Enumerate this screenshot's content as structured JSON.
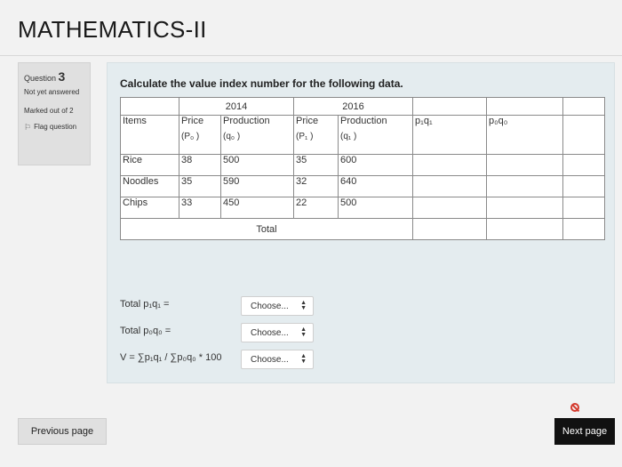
{
  "page": {
    "title": "MATHEMATICS-II"
  },
  "question_info": {
    "question_label": "Question",
    "question_number": "3",
    "status": "Not yet answered",
    "marks": "Marked out of 2",
    "flag_label": "Flag question"
  },
  "question": {
    "text": "Calculate the value index number for the following data.",
    "table": {
      "year_headers": [
        "2014",
        "2016"
      ],
      "column_headers": {
        "items": "Items",
        "price_2014": "Price",
        "production_2014": "Production",
        "price_2016": "Price",
        "production_2016": "Production",
        "p1q1": "p₁q₁",
        "p0q0": "p₀q₀"
      },
      "sub_headers": {
        "price_2014": "(P₀ )",
        "production_2014": "(q₀ )",
        "price_2016": "(P₁ )",
        "production_2016": "(q₁ )"
      },
      "rows": [
        {
          "item": "Rice",
          "p0": "38",
          "q0": "500",
          "p1": "35",
          "q1": "600"
        },
        {
          "item": "Noodles",
          "p0": "35",
          "q0": "590",
          "p1": "32",
          "q1": "640"
        },
        {
          "item": "Chips",
          "p0": "33",
          "q0": "450",
          "p1": "22",
          "q1": "500"
        }
      ],
      "total_label": "Total"
    },
    "calculations": [
      {
        "label": "Total p₁q₁ =",
        "select_value": "Choose..."
      },
      {
        "label": "Total p₀q₀ =",
        "select_value": "Choose..."
      },
      {
        "label": "V = ∑p₁q₁ / ∑p₀q₀  * 100",
        "select_value": "Choose..."
      }
    ]
  },
  "navigation": {
    "previous_label": "Previous page",
    "next_label": "Next page"
  }
}
